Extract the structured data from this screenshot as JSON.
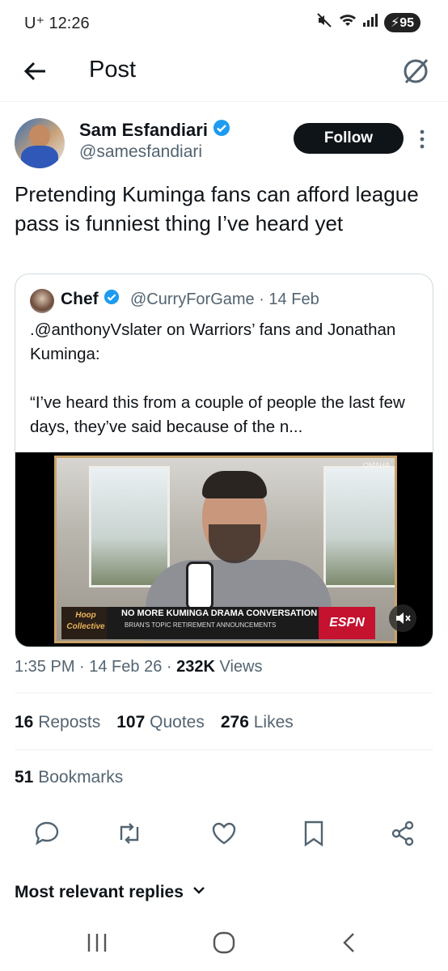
{
  "status_bar": {
    "carrier": "U⁺ 12:26",
    "battery": "95"
  },
  "header": {
    "title": "Post"
  },
  "author": {
    "name": "Sam Esfandiari",
    "handle": "@samesfandiari",
    "follow_label": "Follow"
  },
  "tweet": {
    "text": "Pretending Kuminga fans can afford league pass is funniest thing I’ve heard yet"
  },
  "quote": {
    "name": "Chef",
    "meta": "@CurryForGame · 14 Feb",
    "text": ".@anthonyVslater on Warriors’ fans and Jonathan Kuminga:\n\n“I’ve heard this from a couple of people the last few days, they’ve said because of the n...",
    "video": {
      "chyron_line1": "NO MORE KUMINGA DRAMA CONVERSATION",
      "chyron_line2": "BRIAN'S TOPIC RETIREMENT ANNOUNCEMENTS",
      "show_logo": "Hoop Collective",
      "network": "ESPN",
      "corner": "OMAHA"
    }
  },
  "meta": {
    "time": "1:35 PM · 14 Feb 26 · ",
    "views_count": "232K",
    "views_label": " Views"
  },
  "stats": {
    "reposts_count": "16",
    "reposts_label": "Reposts",
    "quotes_count": "107",
    "quotes_label": "Quotes",
    "likes_count": "276",
    "likes_label": "Likes",
    "bookmarks_count": "51",
    "bookmarks_label": "Bookmarks"
  },
  "replies": {
    "label": "Most relevant replies"
  },
  "icons": [
    "back-arrow-icon",
    "grok-icon",
    "verified-badge-icon",
    "more-vertical-icon",
    "mute-icon",
    "reply-icon",
    "repost-icon",
    "like-icon",
    "bookmark-icon",
    "share-icon",
    "chevron-down-icon",
    "recents-icon",
    "home-icon",
    "back-icon"
  ],
  "colors": {
    "text": "#0f1419",
    "secondary": "#536471",
    "verified": "#1d9bf0",
    "follow_bg": "#0f1419",
    "border": "#cfd9de"
  }
}
